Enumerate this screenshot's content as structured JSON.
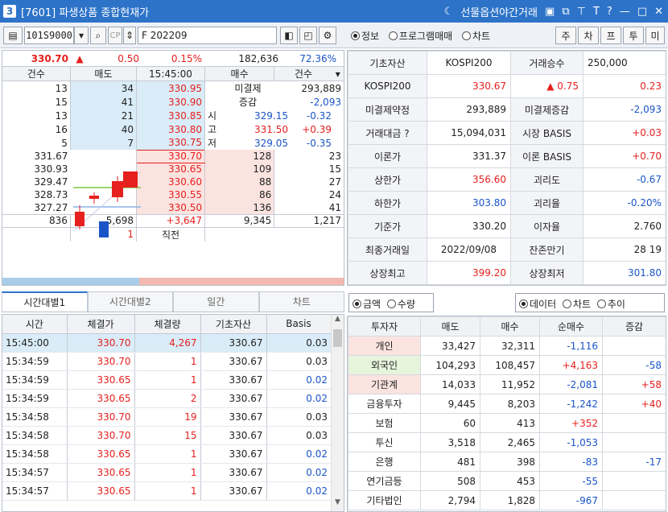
{
  "window": {
    "num": "3",
    "title": "[7601] 파생상품 종합현재가",
    "right_menu": "선물옵션야간거래"
  },
  "toolbar": {
    "code": "101S9000",
    "name": "F 202209",
    "radio_info": "정보",
    "radio_program": "프로그램매매",
    "radio_chart": "차트",
    "btns": [
      "주",
      "차",
      "프",
      "투",
      "미"
    ]
  },
  "summary": {
    "price": "330.70",
    "arrow": "▲",
    "change": "0.50",
    "rate": "0.15%",
    "volume": "182,636",
    "ratio": "72.36%"
  },
  "ob_header": [
    "건수",
    "매도",
    "15:45:00",
    "매수",
    "건수"
  ],
  "asks": [
    {
      "cnt": "13",
      "qty": "34",
      "price": "330.95"
    },
    {
      "cnt": "15",
      "qty": "41",
      "price": "330.90"
    },
    {
      "cnt": "13",
      "qty": "21",
      "price": "330.85"
    },
    {
      "cnt": "16",
      "qty": "40",
      "price": "330.80"
    },
    {
      "cnt": "5",
      "qty": "7",
      "price": "330.75"
    }
  ],
  "ask_info": [
    {
      "k": "미결제",
      "v": "293,889",
      "cls": "blk"
    },
    {
      "k": "증감",
      "v": "-2,093",
      "cls": "dn"
    },
    {
      "k": "시",
      "v": "329.15",
      "d": "-0.32",
      "cls": "dn"
    },
    {
      "k": "고",
      "v": "331.50",
      "d": "+0.39",
      "cls": "up"
    },
    {
      "k": "저",
      "v": "329.05",
      "d": "-0.35",
      "cls": "dn"
    }
  ],
  "chart_axis": [
    "331.67",
    "330.93",
    "329.47",
    "328.73",
    "327.27"
  ],
  "bids": [
    {
      "price": "330.70",
      "qty": "128",
      "cnt": "23"
    },
    {
      "price": "330.65",
      "qty": "109",
      "cnt": "15"
    },
    {
      "price": "330.60",
      "qty": "88",
      "cnt": "27"
    },
    {
      "price": "330.55",
      "qty": "86",
      "cnt": "24"
    },
    {
      "price": "330.50",
      "qty": "136",
      "cnt": "41"
    }
  ],
  "ob_total": {
    "ask_cnt": "836",
    "ask_qty": "5,698",
    "diff": "+3,647",
    "bid_qty": "9,345",
    "bid_cnt": "1,217"
  },
  "ob_last": {
    "qty": "1",
    "label": "직전"
  },
  "info": [
    [
      {
        "l": "기초자산"
      },
      {
        "v": "KOSPI200",
        "c": "c"
      },
      {
        "l": "거래승수"
      },
      {
        "v": "250,000",
        "c": "l"
      }
    ],
    [
      {
        "l": "KOSPI200"
      },
      {
        "v": "330.67",
        "c": "r up"
      },
      {
        "v": "▲ 0.75",
        "c": "r up"
      },
      {
        "v": "0.23",
        "c": "r up"
      }
    ],
    [
      {
        "l": "미결제약정"
      },
      {
        "v": "293,889",
        "c": "r"
      },
      {
        "l": "미결제증감"
      },
      {
        "v": "-2,093",
        "c": "r dn"
      }
    ],
    [
      {
        "l": "거래대금 ?"
      },
      {
        "v": "15,094,031",
        "c": "r"
      },
      {
        "l": "시장 BASIS"
      },
      {
        "v": "+0.03",
        "c": "r up"
      }
    ],
    [
      {
        "l": "이론가"
      },
      {
        "v": "331.37",
        "c": "r"
      },
      {
        "l": "이론 BASIS"
      },
      {
        "v": "+0.70",
        "c": "r up"
      }
    ],
    [
      {
        "l": "상한가"
      },
      {
        "v": "356.60",
        "c": "r up"
      },
      {
        "l": "괴리도"
      },
      {
        "v": "-0.67",
        "c": "r dn"
      }
    ],
    [
      {
        "l": "하한가"
      },
      {
        "v": "303.80",
        "c": "r dn"
      },
      {
        "l": "괴리율"
      },
      {
        "v": "-0.20%",
        "c": "r dn"
      }
    ],
    [
      {
        "l": "기준가"
      },
      {
        "v": "330.20",
        "c": "r"
      },
      {
        "l": "이자율"
      },
      {
        "v": "2.760",
        "c": "r"
      }
    ],
    [
      {
        "l": "최종거래일"
      },
      {
        "v": "2022/09/08",
        "c": "c"
      },
      {
        "l": "잔존만기"
      },
      {
        "v": "28    19",
        "c": "r"
      }
    ],
    [
      {
        "l": "상장최고"
      },
      {
        "v": "399.20",
        "c": "r up"
      },
      {
        "l": "상장최저"
      },
      {
        "v": "301.80",
        "c": "r dn"
      }
    ]
  ],
  "tabs": [
    "시간대별1",
    "시간대별2",
    "일간",
    "차트"
  ],
  "tick_header": [
    "시간",
    "체결가",
    "체결량",
    "기초자산",
    "Basis"
  ],
  "ticks": [
    [
      "15:45:00",
      "330.70",
      "4,267",
      "330.67",
      "0.03"
    ],
    [
      "15:34:59",
      "330.70",
      "1",
      "330.67",
      "0.03"
    ],
    [
      "15:34:59",
      "330.65",
      "1",
      "330.67",
      "0.02"
    ],
    [
      "15:34:59",
      "330.65",
      "2",
      "330.67",
      "0.02"
    ],
    [
      "15:34:58",
      "330.70",
      "19",
      "330.67",
      "0.03"
    ],
    [
      "15:34:58",
      "330.70",
      "15",
      "330.67",
      "0.03"
    ],
    [
      "15:34:58",
      "330.65",
      "1",
      "330.67",
      "0.02"
    ],
    [
      "15:34:57",
      "330.65",
      "1",
      "330.67",
      "0.02"
    ],
    [
      "15:34:57",
      "330.65",
      "1",
      "330.67",
      "0.02"
    ]
  ],
  "inv_opts": {
    "left": [
      "금액",
      "수량"
    ],
    "right": [
      "데이터",
      "차트",
      "추이"
    ]
  },
  "inv_header": [
    "투자자",
    "매도",
    "매수",
    "순매수",
    "증감"
  ],
  "investors": [
    [
      "개인",
      "33,427",
      "32,311",
      "-1,116",
      ""
    ],
    [
      "외국인",
      "104,293",
      "108,457",
      "+4,163",
      "-58"
    ],
    [
      "기관계",
      "14,033",
      "11,952",
      "-2,081",
      "+58"
    ],
    [
      "금융투자",
      "9,445",
      "8,203",
      "-1,242",
      "+40"
    ],
    [
      "보험",
      "60",
      "413",
      "+352",
      ""
    ],
    [
      "투신",
      "3,518",
      "2,465",
      "-1,053",
      ""
    ],
    [
      "은행",
      "481",
      "398",
      "-83",
      "-17"
    ],
    [
      "연기금등",
      "508",
      "453",
      "-55",
      ""
    ],
    [
      "기타법인",
      "2,794",
      "1,828",
      "-967",
      ""
    ]
  ],
  "colors": {
    "title_bar": "#2d73c8",
    "up": "#e6201e",
    "down": "#1a55c8"
  }
}
